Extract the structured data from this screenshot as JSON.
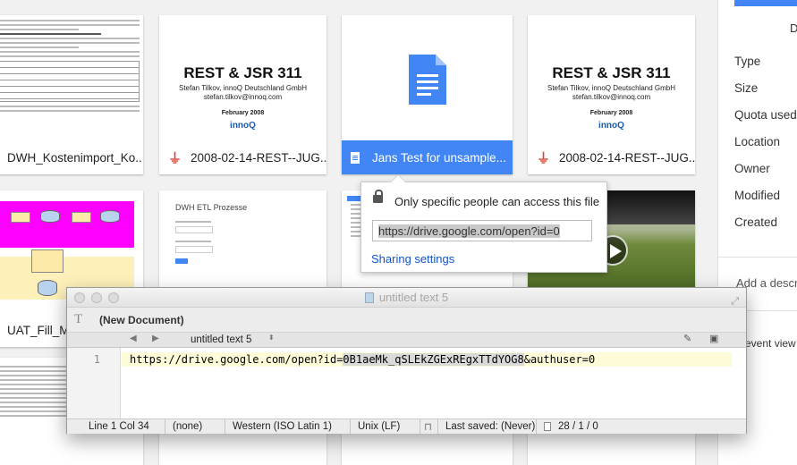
{
  "drive": {
    "cards_row1": [
      {
        "name": "DWH_Kostenimport_Ko...",
        "type": "doc-thumb"
      },
      {
        "name": "2008-02-14-REST--JUG...",
        "type": "pdf",
        "slide_title": "REST & JSR 311",
        "slide_author": "Stefan Tilkov, innoQ Deutschland GmbH",
        "slide_email": "stefan.tilkov@innoq.com",
        "slide_date": "February 2008",
        "slide_logo": "innoQ"
      },
      {
        "name": "Jans Test for unsample...",
        "type": "gdoc",
        "selected": true
      },
      {
        "name": "2008-02-14-REST--JUG...",
        "type": "pdf",
        "slide_title": "REST & JSR 311",
        "slide_author": "Stefan Tilkov, innoQ Deutschland GmbH",
        "slide_email": "stefan.tilkov@innoq.com",
        "slide_date": "February 2008",
        "slide_logo": "innoQ"
      }
    ],
    "cards_row2": [
      {
        "name": "UAT_Fill_M",
        "type": "diagram"
      },
      {
        "name": "DWH ETL Prozesse",
        "type": "doc"
      },
      {
        "name": "",
        "type": "doc"
      },
      {
        "name": "",
        "type": "video"
      }
    ],
    "etl_doc_title": "DWH ETL Prozesse"
  },
  "share_popup": {
    "access_text": "Only specific people can access this file",
    "link_value": "https://drive.google.com/open?id=0",
    "settings_link": "Sharing settings"
  },
  "right_panel": {
    "header_fragment": "D",
    "labels": [
      "Type",
      "Size",
      "Quota used",
      "Location",
      "Owner",
      "Modified",
      "Created"
    ],
    "add_description": "Add a descr",
    "event_view": "event view"
  },
  "editor": {
    "window_title": "untitled text 5",
    "doc_label": "(New Document)",
    "tab_name": "untitled text 5",
    "line_number": "1",
    "url_before": "https://drive.google.com/open?id=",
    "url_selected": "0B1aeMk_qSLEkZGExREgxTTdYOG8",
    "url_after": "&authuser=0",
    "status": {
      "position": "Line 1 Col 34",
      "syntax": "(none)",
      "encoding": "Western (ISO Latin 1)",
      "line_endings": "Unix (LF)",
      "saved": "Last saved: (Never)",
      "counts": "28 / 1 / 0"
    }
  },
  "colors": {
    "selected_blue": "#4285f4",
    "pdf_red": "#db4437",
    "diagram_magenta": "#ff00ff"
  }
}
